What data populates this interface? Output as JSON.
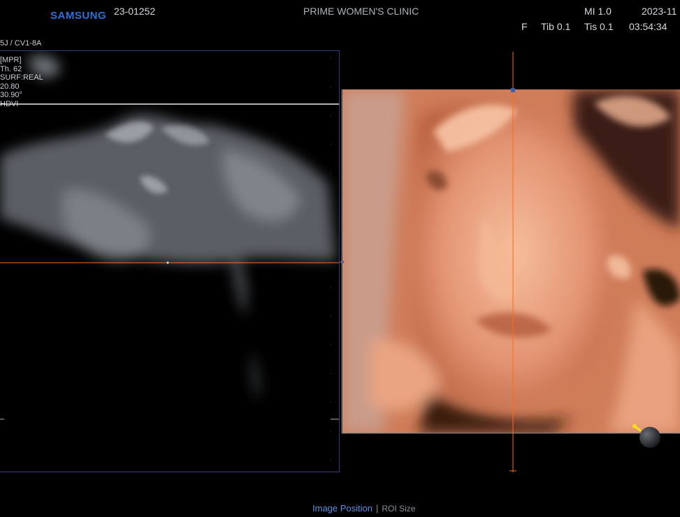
{
  "header": {
    "brand": "SAMSUNG",
    "patient_id": "23-01252",
    "clinic": "PRIME WOMEN'S CLINIC",
    "mi": "MI  1.0",
    "date": "2023-11",
    "f": "F",
    "tib": "Tib 0.1",
    "tis": "Tis 0.1",
    "time": "03:54:34"
  },
  "probe": "5J / CV1-8A",
  "params": [
    "[MPR]",
    "Th. 62",
    "SURF:REAL",
    "20.80",
    "30.90°",
    "HDVI"
  ],
  "bottom": {
    "image_position": "Image Position",
    "separator": "|",
    "roi_size": "ROI Size"
  },
  "colors": {
    "accent": "#5b8fe0",
    "crosshair": "#ff6a1a",
    "frame": "#2a3d80",
    "brand": "#2e6fd8"
  }
}
